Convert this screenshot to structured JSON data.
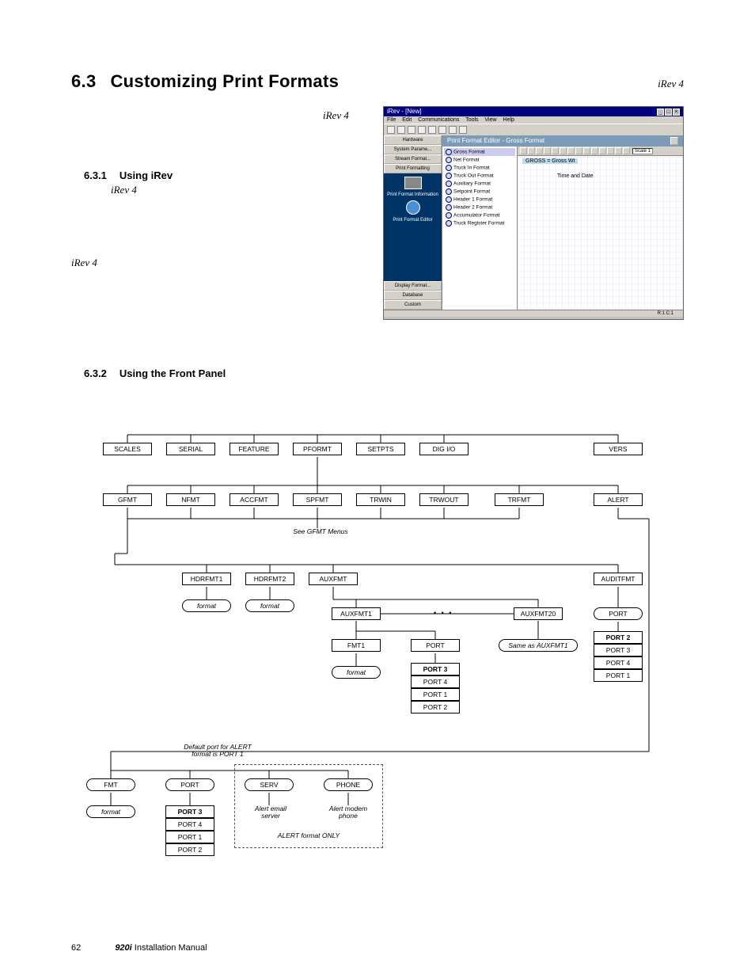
{
  "section": {
    "num": "6.3",
    "title": "Customizing Print Formats"
  },
  "iRev_right": "iRev 4",
  "iRev_top": "iRev 4",
  "sub1": {
    "num": "6.3.1",
    "title": "Using iRev",
    "note": "iRev 4"
  },
  "iRev_left": "iRev 4",
  "sub2": {
    "num": "6.3.2",
    "title": "Using the Front Panel"
  },
  "app": {
    "title": "iRev - [New]",
    "menus": [
      "File",
      "Edit",
      "Communications",
      "Tools",
      "View",
      "Help"
    ],
    "left_tabs_top": [
      "Hardware",
      "System Parame...",
      "Stream Format...",
      "Print Formatting"
    ],
    "left_active": [
      "Print Format Information",
      "Print Format Editor"
    ],
    "left_tabs_bottom": [
      "Display Format...",
      "Database",
      "Custom"
    ],
    "panel_title": "Print Format Editor - Gross Format",
    "format_list": [
      "Gross Format",
      "Net Format",
      "Truck In Format",
      "Truck Out Format",
      "Auxiliary Format",
      "Setpoint Format",
      "Header 1 Format",
      "Header 2 Format",
      "Accumulator Format",
      "Truck Register Format"
    ],
    "canvas_labels": {
      "gross": "GROSS =   Gross Wt",
      "td": "Time and Date"
    },
    "scale_select": "Scale 1",
    "status": "R:1  C:1"
  },
  "diagram": {
    "row1": [
      "SCALES",
      "SERIAL",
      "FEATURE",
      "PFORMT",
      "SETPTS",
      "DIG I/O",
      "VERS"
    ],
    "row2": [
      "GFMT",
      "NFMT",
      "ACCFMT",
      "SPFMT",
      "TRWIN",
      "TRWOUT",
      "TRFMT",
      "ALERT"
    ],
    "see": "See GFMT Menus",
    "row3": [
      "HDRFMT1",
      "HDRFMT2",
      "AUXFMT",
      "AUDITFMT"
    ],
    "fmt": "format",
    "aux1": "AUXFMT1",
    "aux20": "AUXFMT20",
    "fmt1": "FMT1",
    "port": "PORT",
    "same_aux": "Same as AUXFMT1",
    "ports_left": [
      "PORT 3",
      "PORT 4",
      "PORT 1",
      "PORT 2"
    ],
    "ports_right": [
      "PORT 2",
      "PORT 3",
      "PORT 4",
      "PORT 1"
    ],
    "bottom": {
      "fmt": "FMT",
      "port": "PORT",
      "serv": "SERV",
      "phone": "PHONE",
      "serv_note": "Alert email server",
      "phone_note": "Alert modem phone",
      "alert_only": "ALERT format ONLY",
      "default_note": "Default port for ALERT\nformat is PORT 1",
      "ports": [
        "PORT 3",
        "PORT 4",
        "PORT 1",
        "PORT 2"
      ]
    }
  },
  "footer": {
    "page": "62",
    "model": "920i",
    "manual": " Installation Manual"
  }
}
